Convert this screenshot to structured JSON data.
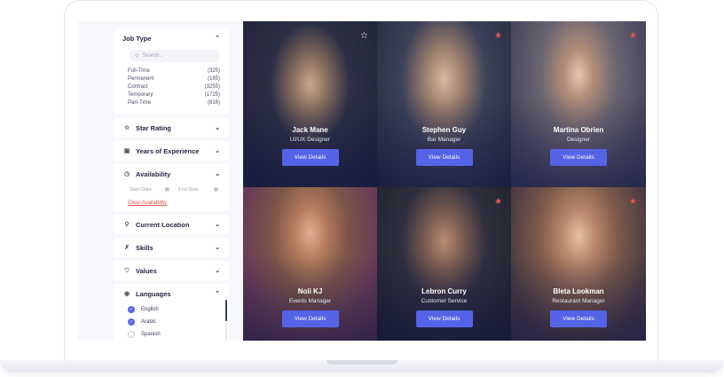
{
  "sidebar": {
    "job_type": {
      "title": "Job Type",
      "search_placeholder": "Search...",
      "items": [
        {
          "label": "Full-Time",
          "count": "(325)"
        },
        {
          "label": "Permanent",
          "count": "(185)"
        },
        {
          "label": "Contract",
          "count": "(3255)"
        },
        {
          "label": "Temporary",
          "count": "(1725)"
        },
        {
          "label": "Part-Time",
          "count": "(816)"
        }
      ]
    },
    "star_rating": {
      "title": "Star Rating"
    },
    "years_experience": {
      "title": "Years of Experience"
    },
    "availability": {
      "title": "Availability",
      "start_date": "Start Date",
      "end_date": "End Date",
      "clear_label": "Clear Availability"
    },
    "current_location": {
      "title": "Current Location"
    },
    "skills": {
      "title": "Skills"
    },
    "values": {
      "title": "Values"
    },
    "languages": {
      "title": "Languages",
      "items": [
        {
          "label": "English",
          "checked": true
        },
        {
          "label": "Arabic",
          "checked": true
        },
        {
          "label": "Spanish",
          "checked": false
        }
      ]
    }
  },
  "profiles": [
    {
      "name": "Jack Mane",
      "role": "UI/UX Designer",
      "button": "View Details",
      "starred": false,
      "bg": "#3a3e55"
    },
    {
      "name": "Stephen Guy",
      "role": "Bar Manager",
      "button": "View Details",
      "starred": true,
      "bg": "#4a4f63"
    },
    {
      "name": "Martina Obrien",
      "role": "Designer",
      "button": "View Details",
      "starred": true,
      "bg": "#6e6c74"
    },
    {
      "name": "Noli KJ",
      "role": "Events Manager",
      "button": "View Details",
      "starred": false,
      "bg": "#8a6a5a"
    },
    {
      "name": "Lebron Curry",
      "role": "Customer Service",
      "button": "View Details",
      "starred": true,
      "bg": "#3b3c48"
    },
    {
      "name": "Bleta Lookman",
      "role": "Restaurant Manager",
      "button": "View Details",
      "starred": true,
      "bg": "#7a5a48"
    }
  ],
  "colors": {
    "accent": "#5563e6",
    "star_active": "#e2574c",
    "clear_link": "#e2574c"
  }
}
